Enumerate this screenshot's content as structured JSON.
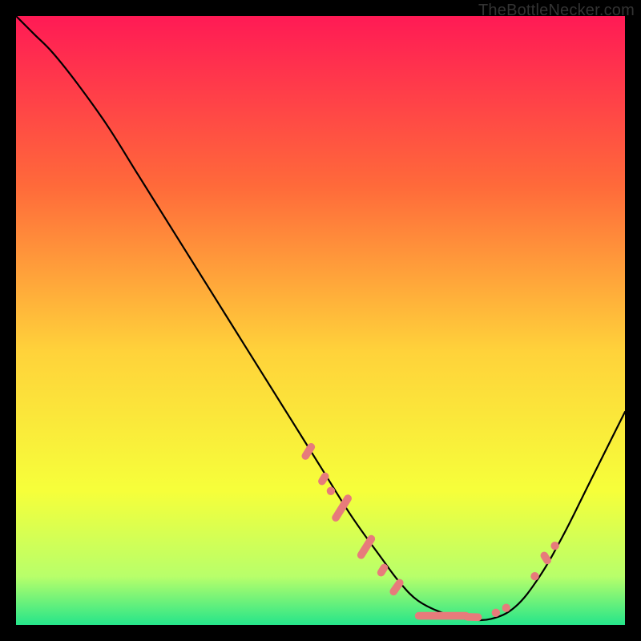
{
  "watermark": "TheBottleNecker.com",
  "colors": {
    "page_bg": "#000000",
    "curve_stroke": "#000000",
    "marker_fill": "#e77b7b",
    "marker_stroke": "#e77b7b",
    "gradient_top": "#ff1a55",
    "gradient_mid_upper": "#ff6a3a",
    "gradient_mid": "#ffd23a",
    "gradient_mid_lower": "#f6ff3a",
    "gradient_near_bottom": "#b8ff6a",
    "gradient_bottom": "#25e58a",
    "watermark_color": "#333333"
  },
  "chart_data": {
    "type": "line",
    "title": "",
    "xlabel": "",
    "ylabel": "",
    "xlim": [
      0,
      100
    ],
    "ylim": [
      0,
      100
    ],
    "x": [
      0,
      3,
      6,
      10,
      15,
      20,
      25,
      30,
      35,
      40,
      45,
      50,
      55,
      60,
      63,
      66,
      70,
      74,
      78,
      82,
      86,
      90,
      94,
      98,
      100
    ],
    "y": [
      100,
      97,
      94,
      89,
      82,
      74,
      66,
      58,
      50,
      42,
      34,
      26,
      18,
      11,
      7,
      4,
      2,
      1,
      1,
      3,
      8,
      15,
      23,
      31,
      35
    ],
    "markers": {
      "segments": [
        {
          "x": 48.0,
          "y": 28.5,
          "len": 3.0,
          "angle": -58
        },
        {
          "x": 50.5,
          "y": 24.0,
          "len": 2.2,
          "angle": -58
        },
        {
          "x": 53.5,
          "y": 19.2,
          "len": 5.0,
          "angle": -58
        },
        {
          "x": 57.5,
          "y": 12.8,
          "len": 4.4,
          "angle": -58
        },
        {
          "x": 60.2,
          "y": 9.0,
          "len": 2.2,
          "angle": -58
        },
        {
          "x": 62.5,
          "y": 6.2,
          "len": 3.0,
          "angle": -55
        },
        {
          "x": 70.0,
          "y": 1.5,
          "len": 9.0,
          "angle": 0
        },
        {
          "x": 75.0,
          "y": 1.3,
          "len": 3.0,
          "angle": 2
        },
        {
          "x": 87.0,
          "y": 11.0,
          "len": 2.2,
          "angle": 58
        }
      ],
      "dots": [
        {
          "x": 51.7,
          "y": 22.0
        },
        {
          "x": 78.8,
          "y": 2.0
        },
        {
          "x": 80.5,
          "y": 2.8
        },
        {
          "x": 85.2,
          "y": 8.0
        },
        {
          "x": 88.5,
          "y": 13.0
        }
      ]
    },
    "plot_bg": "vertical-gradient"
  }
}
